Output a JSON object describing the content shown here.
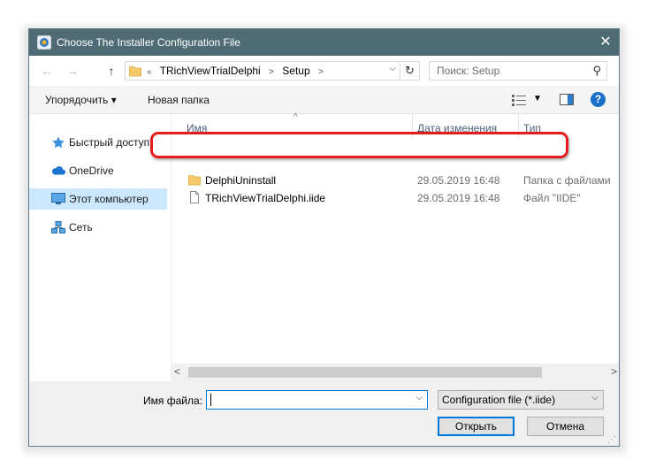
{
  "window": {
    "title": "Choose The Installer Configuration File",
    "close_icon": "close-icon",
    "colors": {
      "titlebar": "#4f6b76",
      "accent": "#0078d7",
      "highlight": "#e51c1c",
      "selection": "#cce8ff"
    }
  },
  "navigation": {
    "back_icon": "arrow-left-icon",
    "forward_icon": "arrow-right-icon",
    "up_icon": "arrow-up-icon",
    "address": {
      "overflow": "«",
      "crumbs": [
        "TRichViewTrialDelphi",
        "Setup"
      ]
    },
    "refresh_icon": "refresh-icon",
    "search_placeholder": "Поиск: Setup"
  },
  "toolbar": {
    "organize_label": "Упорядочить ▾",
    "new_folder_label": "Новая папка"
  },
  "sidebar": {
    "items": [
      {
        "label": "Быстрый доступ",
        "icon": "star-icon"
      },
      {
        "label": "OneDrive",
        "icon": "cloud-icon"
      },
      {
        "label": "Этот компьютер",
        "icon": "computer-icon",
        "selected": true
      },
      {
        "label": "Сеть",
        "icon": "network-icon"
      }
    ]
  },
  "file_list": {
    "columns": {
      "name": "Имя",
      "date": "Дата изменения",
      "type": "Тип"
    },
    "rows": [
      {
        "name": "DelphiUninstall",
        "date": "29.05.2019 16:48",
        "type": "Папка с файлами",
        "icon": "folder-icon"
      },
      {
        "name": "TRichViewTrialDelphi.iide",
        "date": "29.05.2019 16:48",
        "type": "Файл \"IIDE\"",
        "icon": "file-icon"
      }
    ]
  },
  "footer": {
    "filename_label": "Имя файла:",
    "filename_value": "",
    "filetype_selected": "Configuration file (*.iide)",
    "open_label": "Открыть",
    "cancel_label": "Отмена"
  }
}
